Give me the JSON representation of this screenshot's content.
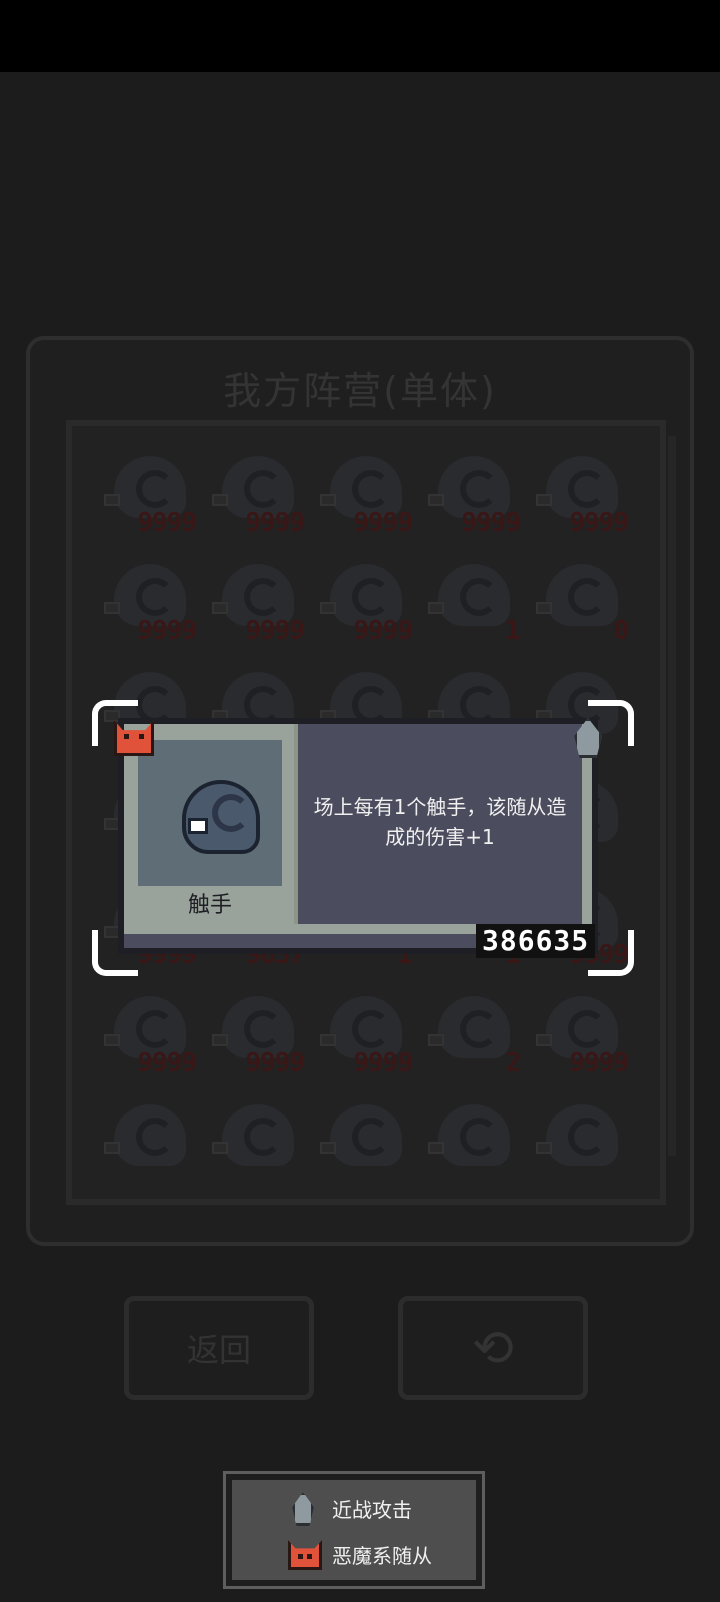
{
  "panel": {
    "title": "我方阵营(单体)",
    "units": [
      [
        "9999",
        "9999",
        "9999",
        "9999",
        "9999"
      ],
      [
        "9999",
        "9999",
        "9999",
        "1",
        "0"
      ],
      [
        "",
        "",
        "",
        "",
        ""
      ],
      [
        "",
        "",
        "",
        "",
        ""
      ],
      [
        "9999",
        "9637",
        "1",
        "1",
        "9999"
      ],
      [
        "9999",
        "9999",
        "9999",
        "2",
        "9999"
      ],
      [
        "",
        "",
        "",
        "",
        ""
      ]
    ]
  },
  "buttons": {
    "back_label": "返回",
    "refresh_glyph": "⟲"
  },
  "card": {
    "name": "触手",
    "description": "场上每有1个触手，该随从造成的伤害+1",
    "score": "386635",
    "portrait_icon": "tentacle-icon",
    "faction_icon": "demon-icon",
    "attack_icon": "sword-icon"
  },
  "legend": {
    "items": [
      {
        "icon": "sword-icon",
        "label": "近战攻击"
      },
      {
        "icon": "demon-icon",
        "label": "恶魔系随从"
      }
    ]
  },
  "colors": {
    "background": "#1c1c1c",
    "card_body": "#9aa39b",
    "desc_bg": "#4b4d5e",
    "demon": "#e0523a",
    "dim_number": "#3a1717"
  }
}
